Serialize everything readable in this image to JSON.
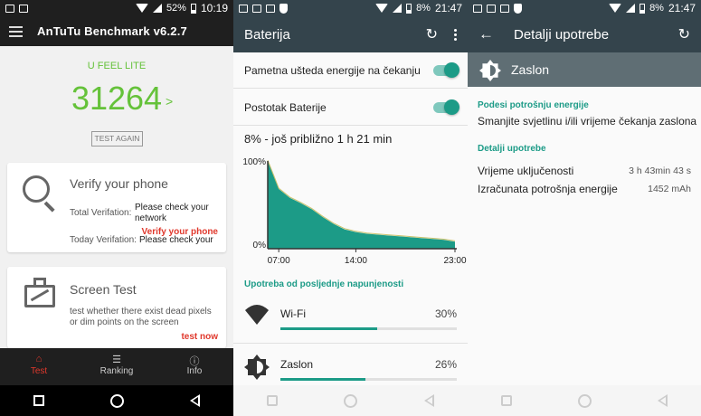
{
  "antutu": {
    "status": {
      "battery": "52%",
      "time": "10:19"
    },
    "title": "AnTuTu Benchmark v6.2.7",
    "tagline": "U FEEL LITE",
    "score": "31264",
    "score_arrow": ">",
    "test_again": "TEST AGAIN",
    "verify_card": {
      "title": "Verify your phone",
      "total_label": "Total Verifation:",
      "total_value": "Please check your",
      "total_value2": "network",
      "today_label": "Today Verifation:",
      "today_value": "Please check your",
      "link": "Verify your phone"
    },
    "screen_card": {
      "title": "Screen Test",
      "line1": "test whether there exist dead pixels",
      "line2": "or dim points on the screen",
      "link": "test now"
    },
    "nav": [
      {
        "label": "Test",
        "icon": "home-icon",
        "active": true
      },
      {
        "label": "Ranking",
        "icon": "list-icon",
        "active": false
      },
      {
        "label": "Info",
        "icon": "info-icon",
        "active": false
      }
    ]
  },
  "battery": {
    "status": {
      "battery": "8%",
      "time": "21:47"
    },
    "title": "Baterija",
    "rows": [
      {
        "label": "Pametna ušteda energije na čekanju",
        "on": true
      },
      {
        "label": "Postotak Baterije",
        "on": true
      }
    ],
    "estimate": "8% - još približno 1 h 21 min",
    "usage_header": "Upotreba od posljednje napunjenosti",
    "usage": [
      {
        "name": "Wi-Fi",
        "pct": "30%",
        "level": 0.55,
        "icon": "wifi-icon"
      },
      {
        "name": "Zaslon",
        "pct": "26%",
        "level": 0.48,
        "icon": "brightness-icon"
      }
    ],
    "colors": {
      "accent": "#1c9b87",
      "bar": "#34444c"
    }
  },
  "chart_data": {
    "type": "area",
    "ylim": [
      0,
      100
    ],
    "y_tick_labels": [
      "100%",
      "0%"
    ],
    "x_tick_labels": [
      "07:00",
      "14:00",
      "23:00"
    ],
    "x": [
      6,
      7,
      8,
      9,
      10,
      11,
      12,
      13,
      14,
      15,
      16,
      17,
      18,
      19,
      20,
      21,
      22,
      23
    ],
    "values": [
      100,
      68,
      58,
      52,
      45,
      36,
      28,
      22,
      19,
      17,
      16,
      15,
      14,
      13,
      12,
      11,
      10,
      8
    ]
  },
  "detail": {
    "status": {
      "battery": "8%",
      "time": "21:47"
    },
    "title": "Detalji upotrebe",
    "item": "Zaslon",
    "adjust_head": "Podesi potrošnju energije",
    "adjust_text": "Smanjite svjetlinu i/ili vrijeme čekanja zaslona",
    "details_head": "Detalji upotrebe",
    "rows": [
      {
        "label": "Vrijeme uključenosti",
        "value": "3 h 43min 43 s"
      },
      {
        "label": "Izračunata potrošnja energije",
        "value": "1452 mAh"
      }
    ]
  }
}
